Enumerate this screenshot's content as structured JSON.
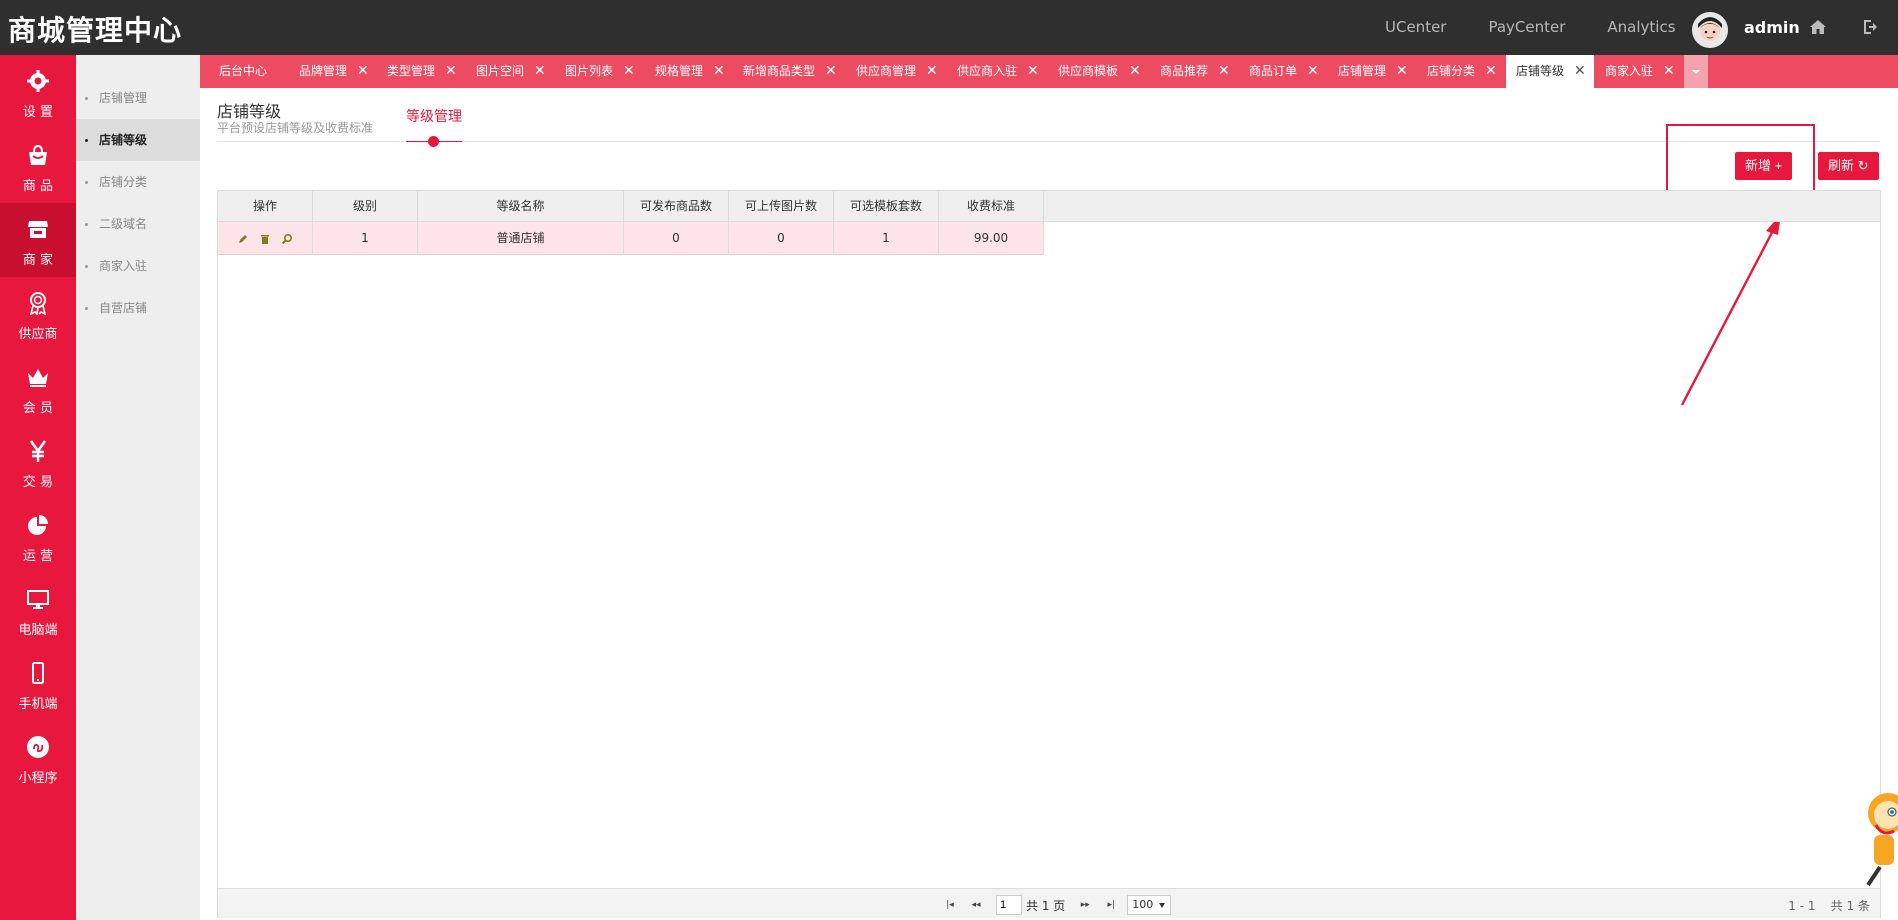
{
  "header": {
    "brand": "商城管理中心",
    "links": [
      "UCenter",
      "PayCenter",
      "Analytics"
    ],
    "user": "admin",
    "icons": [
      "avatar",
      "home-icon",
      "logout-icon"
    ]
  },
  "mainnav": [
    {
      "label": "设 置",
      "icon": "gear-icon"
    },
    {
      "label": "商 品",
      "icon": "shopping-bag-icon"
    },
    {
      "label": "商 家",
      "icon": "store-icon",
      "active": true
    },
    {
      "label": "供应商",
      "icon": "medal-icon"
    },
    {
      "label": "会 员",
      "icon": "crown-icon"
    },
    {
      "label": "交 易",
      "icon": "yen-icon"
    },
    {
      "label": "运 营",
      "icon": "pie-chart-icon"
    },
    {
      "label": "电脑端",
      "icon": "monitor-icon"
    },
    {
      "label": "手机端",
      "icon": "phone-icon"
    },
    {
      "label": "小程序",
      "icon": "mini-program-icon"
    }
  ],
  "subnav": [
    "店铺管理",
    "店铺等级",
    "店铺分类",
    "二级域名",
    "商家入驻",
    "自营店铺"
  ],
  "tabs": [
    "后台中心",
    "品牌管理",
    "类型管理",
    "图片空间",
    "图片列表",
    "规格管理",
    "新增商品类型",
    "供应商管理",
    "供应商入驻",
    "供应商模板",
    "商品推荐",
    "商品订单",
    "店铺管理",
    "店铺分类",
    "店铺等级",
    "商家入驻"
  ],
  "page": {
    "title": "店铺等级",
    "subtitle": "平台预设店铺等级及收费标准",
    "step": "等级管理"
  },
  "toolbar": {
    "add": "新增 +",
    "refresh": "刷新 ↻"
  },
  "grid": {
    "columns": [
      "操作",
      "级别",
      "等级名称",
      "可发布商品数",
      "可上传图片数",
      "可选模板套数",
      "收费标准"
    ],
    "rows": [
      {
        "level": "1",
        "name": "普通店铺",
        "goods": "0",
        "images": "0",
        "templates": "1",
        "fee": "99.00"
      }
    ]
  },
  "pager": {
    "page": "1",
    "total_pages": "共 1 页",
    "page_size": "100",
    "range": "1 - 1",
    "total": "共 1 条"
  },
  "colors": {
    "accent": "#e8173d",
    "tabbar": "#ec4b62",
    "header": "#2f2f2f"
  }
}
